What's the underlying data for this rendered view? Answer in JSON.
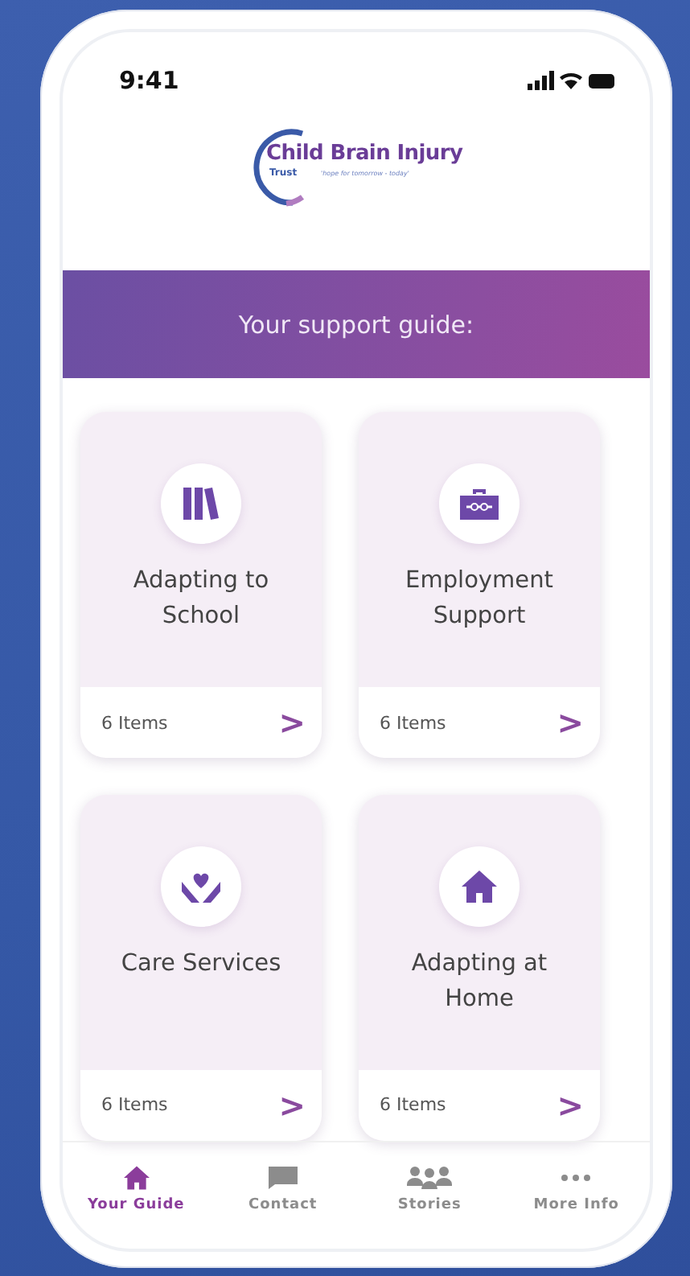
{
  "status_bar": {
    "time": "9:41"
  },
  "logo": {
    "name": "Child Brain Injury",
    "subname": "Trust",
    "tagline": "'hope for tomorrow - today'"
  },
  "banner": {
    "title": "Your support guide:"
  },
  "cards": [
    {
      "title": "Adapting to School",
      "count": "6 Items",
      "arrow": ">"
    },
    {
      "title": "Employment Support",
      "count": "6 Items",
      "arrow": ">"
    },
    {
      "title": "Care Services",
      "count": "6 Items",
      "arrow": ">"
    },
    {
      "title": "Adapting at Home",
      "count": "6 Items",
      "arrow": ">"
    }
  ],
  "tab_bar": [
    {
      "label": "Your Guide",
      "selected": true
    },
    {
      "label": "Contact",
      "selected": false
    },
    {
      "label": "Stories",
      "selected": false
    },
    {
      "label": "More Info",
      "selected": false
    }
  ]
}
